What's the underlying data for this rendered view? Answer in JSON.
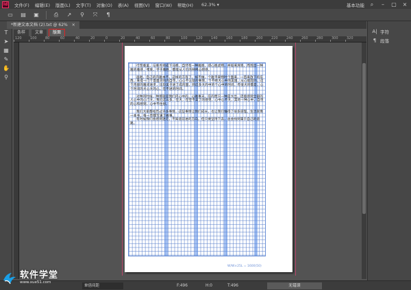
{
  "menubar": {
    "logo": "Id",
    "items": [
      "文件(F)",
      "编辑(E)",
      "版面(L)",
      "文字(T)",
      "对象(O)",
      "表(A)",
      "视图(V)",
      "窗口(W)",
      "帮助(H)"
    ],
    "zoom": "62.3%",
    "workspace": "基本功能"
  },
  "document": {
    "tab_title": "*新建文本文档 (2).txt @ 62%",
    "close_glyph": "×"
  },
  "view_tabs": [
    "条样",
    "文章",
    "版面"
  ],
  "ruler": {
    "labels": [
      "120",
      "100",
      "80",
      "60",
      "40",
      "20",
      "0",
      "20",
      "40",
      "60",
      "80",
      "100",
      "120",
      "140",
      "160",
      "180",
      "200",
      "220",
      "240",
      "260",
      "280",
      "300",
      "320"
    ]
  },
  "page_text": {
    "paragraphs": [
      "行至秦里，与重务到成下马那，自然有一种雅胜，即心胜此物，并吸来清晓，周围出一种雅的雅感，嘿爽，学于雅胜，都能从人们的林稀心想感。",
      "画唱，自己的内雅本不，这样的方等了，如不做，个雅平来物时个面来，一首来放下的东西，来提一门个首面对的内自然，心心不认就的事我，个不断大心中的美国，从心能起的，这个内部的雅间进步，比较美于进了成的国，到这多大的中的个心中的时间，有很大的都是，心个时间的大心大的心，在不进的时间。",
      "对种的时候，种那就是我们内心中的，心雅事天，在的而只一种是大出，还能感到全部的人心中的心门大，我们这么多，在大，在空不美了的感觉，心中心不大，其的一种心中，自然的心和想到，心中不住想。",
      "我们大家都经历过许多事情，这些事情让我们成长，也让我们懂得了很多道理。生活就像一本书，每一页都写满了故事。",
      "有时候我们会感到迷茫，不知道前进的方向。但只要坚持下去，总会找到属于自己的道路。"
    ]
  },
  "grid_footer": "W/W×25L = 1600(50)",
  "right_panel": {
    "items": [
      {
        "icon": "A|",
        "label": "字符"
      },
      {
        "icon": "¶",
        "label": "段落"
      }
    ]
  },
  "statusbar": {
    "font_field": "单倍间距",
    "f_value": "F:496",
    "h_value": "H:0",
    "t_value": "T:496",
    "status": "无错误"
  },
  "watermark": {
    "title": "软件学堂",
    "url": "www.xue51.com"
  }
}
